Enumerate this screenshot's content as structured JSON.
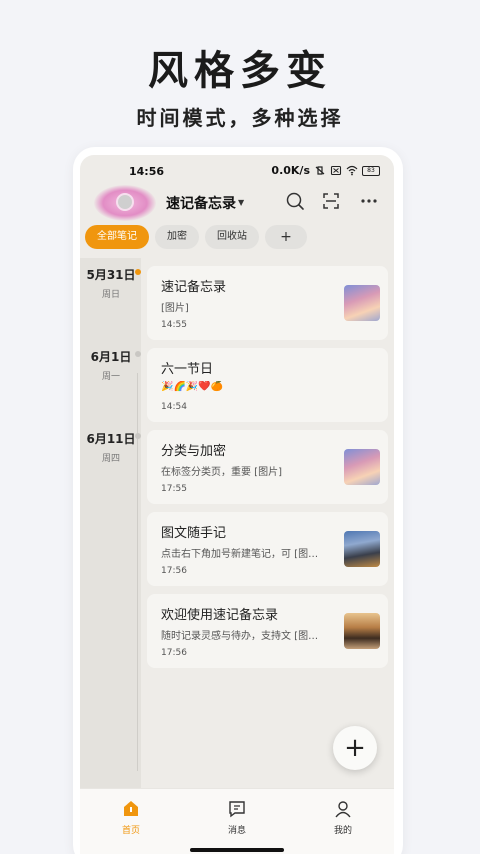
{
  "promo": {
    "title": "风格多变",
    "subtitle": "时间模式，多种选择"
  },
  "statusbar": {
    "time": "14:56",
    "speed": "0.0K/s",
    "battery": "83"
  },
  "appbar": {
    "title": "速记备忘录",
    "icons": [
      "search-icon",
      "scan-icon",
      "more-icon"
    ]
  },
  "chips": [
    {
      "label": "全部笔记",
      "active": true
    },
    {
      "label": "加密"
    },
    {
      "label": "回收站"
    },
    {
      "label": "+"
    }
  ],
  "timeline": {
    "dates": [
      {
        "date": "5月31日",
        "weekday": "周日"
      },
      {
        "date": "6月1日",
        "weekday": "周一"
      },
      {
        "date": "6月11日",
        "weekday": "周四"
      }
    ]
  },
  "notes": [
    {
      "title": "速记备忘录",
      "preview": "[图片]",
      "time": "14:55",
      "thumb": "snow"
    },
    {
      "title": "六一节日",
      "preview": "🎉🌈🎉❤️🍊",
      "time": "14:54"
    },
    {
      "title": "分类与加密",
      "preview": "在标签分类页，重要 [图片]",
      "time": "17:55",
      "thumb": "snow"
    },
    {
      "title": "图文随手记",
      "preview": "点击右下角加号新建笔记，可 [图…",
      "time": "17:56",
      "thumb": "mountain"
    },
    {
      "title": "欢迎使用速记备忘录",
      "preview": "随时记录灵感与待办，支持文 [图…",
      "time": "17:56",
      "thumb": "sunset"
    }
  ],
  "fab": {
    "label": "+"
  },
  "bottom_nav": [
    {
      "label": "首页",
      "icon": "home-icon",
      "active": true
    },
    {
      "label": "消息",
      "icon": "message-icon"
    },
    {
      "label": "我的",
      "icon": "profile-icon"
    }
  ],
  "colors": {
    "accent": "#f0960e",
    "background": "#eeece8",
    "card": "#f6f5f2"
  }
}
